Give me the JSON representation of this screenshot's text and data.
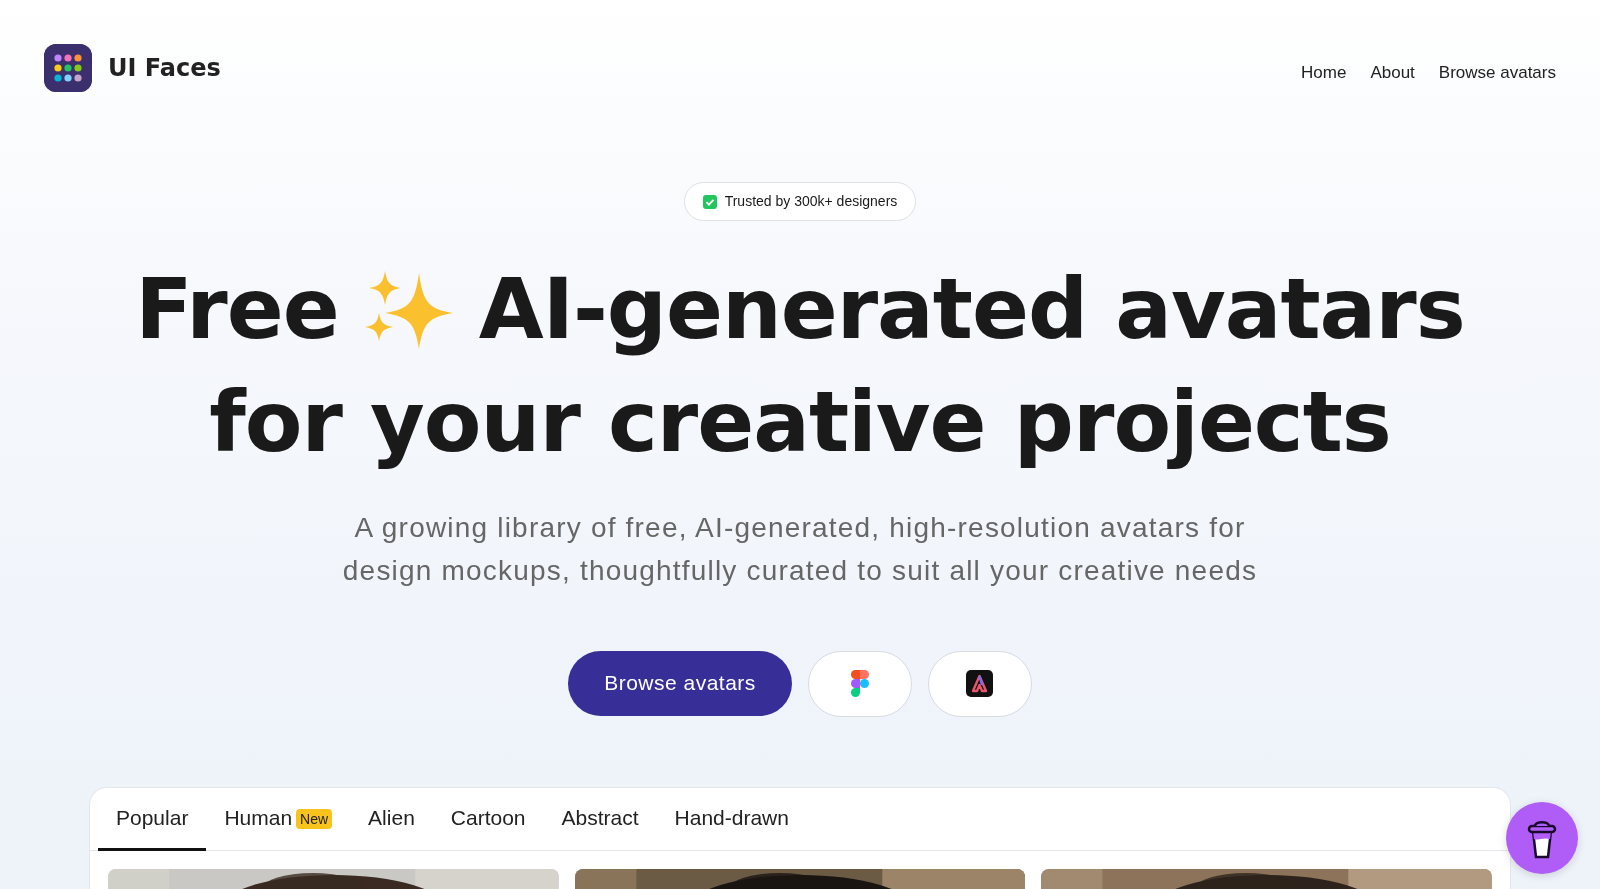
{
  "brand": {
    "name": "UI Faces"
  },
  "nav": [
    {
      "label": "Home"
    },
    {
      "label": "About"
    },
    {
      "label": "Browse avatars"
    }
  ],
  "trust_badge": {
    "text": "Trusted by 300k+ designers",
    "checked": true
  },
  "headline": {
    "lead": "Free",
    "rest": "AI-generated avatars",
    "line_2": "for your creative projects"
  },
  "subtitle": "A growing library of free, AI-generated, high-resolution avatars for design mockups, thoughtfully curated to suit all your creative needs",
  "cta": {
    "label": "Browse avatars"
  },
  "tabs": [
    {
      "label": "Popular",
      "selected": true
    },
    {
      "label": "Human",
      "badge": "New",
      "selected": false
    },
    {
      "label": "Alien",
      "selected": false
    },
    {
      "label": "Cartoon",
      "selected": false
    },
    {
      "label": "Abstract",
      "selected": false
    },
    {
      "label": "Hand-drawn",
      "selected": false
    }
  ]
}
